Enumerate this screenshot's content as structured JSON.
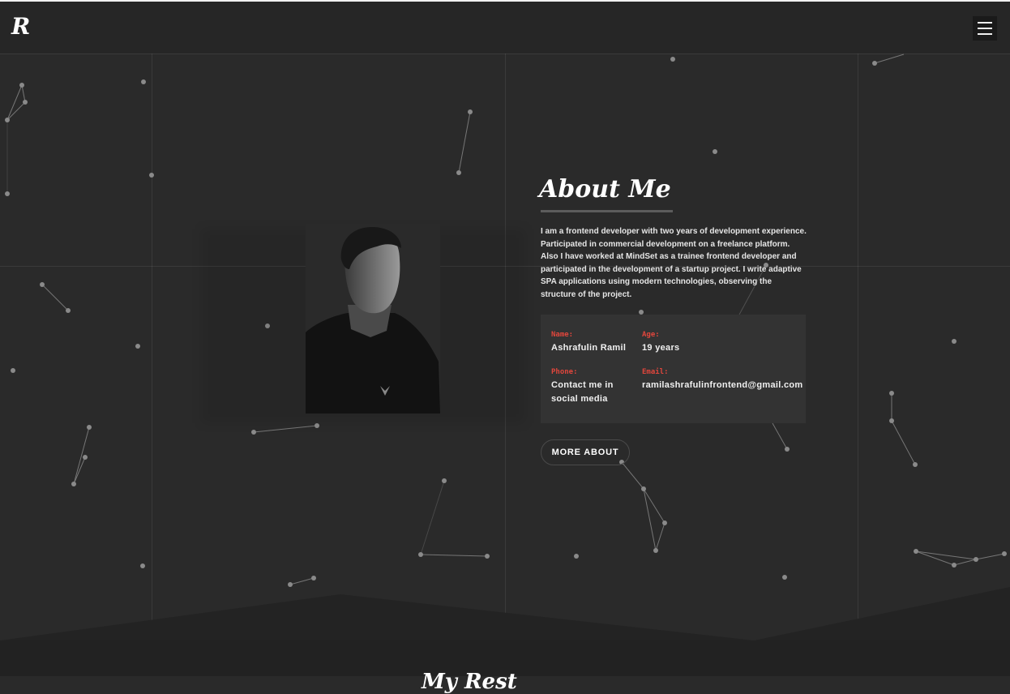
{
  "header": {
    "logo_text": "R",
    "menu_icon": "hamburger-menu-icon"
  },
  "about": {
    "title": "About Me",
    "description": "I am a frontend developer with two years of development experience. Participated in commercial development on a freelance platform. Also I have worked at MindSet as a trainee frontend developer and participated in the development of a startup project. I write adaptive SPA applications using modern technologies, observing the structure of the project.",
    "info": {
      "name_label": "Name:",
      "name_value": "Ashrafulin Ramil",
      "age_label": "Age:",
      "age_value": "19 years",
      "phone_label": "Phone:",
      "phone_value": "Contact me in social media",
      "email_label": "Email:",
      "email_value": "ramilashrafulinfrontend@gmail.com"
    },
    "more_button": "MORE ABOUT"
  },
  "next_section": {
    "heading": "My Rest"
  },
  "colors": {
    "background": "#2a2a2a",
    "header": "#262626",
    "card": "#333333",
    "accent_label": "#e0463c"
  }
}
